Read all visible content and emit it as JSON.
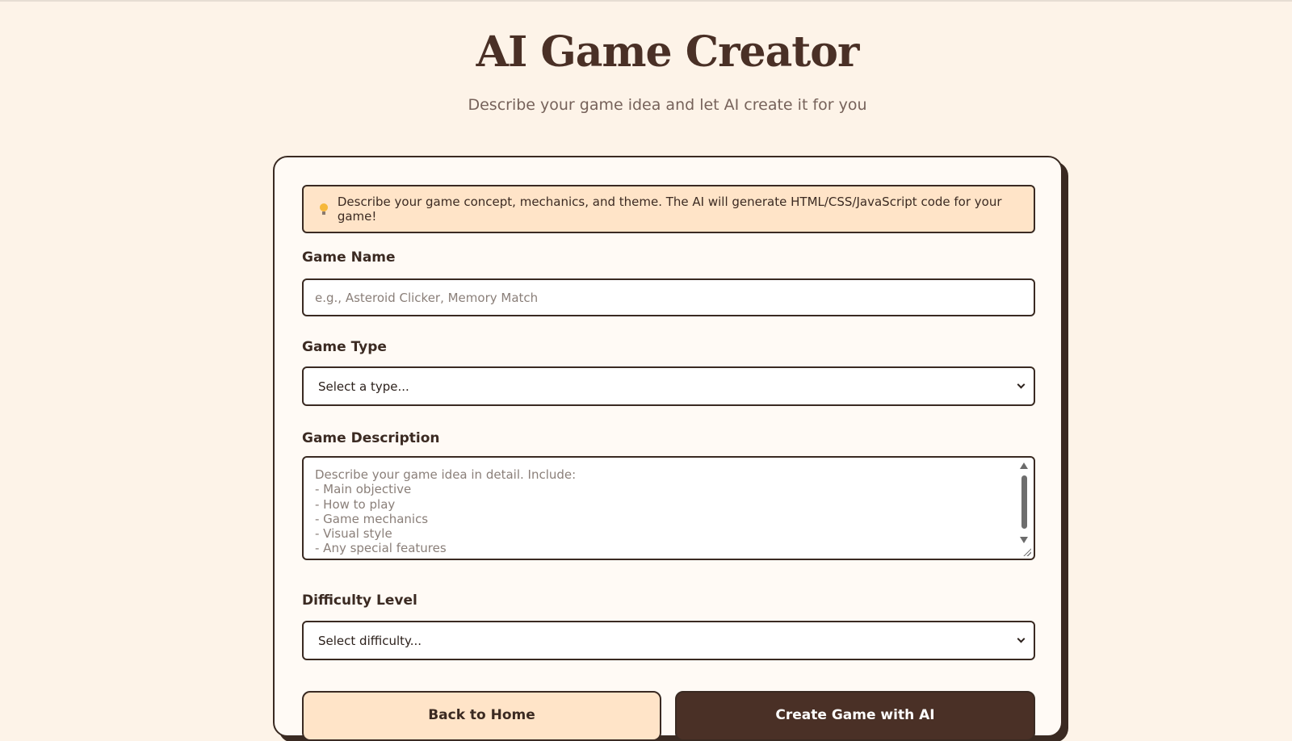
{
  "header": {
    "title": "AI Game Creator",
    "subtitle": "Describe your game idea and let AI create it for you"
  },
  "info": {
    "icon": "lightbulb-icon",
    "text": "Describe your game concept, mechanics, and theme. The AI will generate HTML/CSS/JavaScript code for your game!"
  },
  "form": {
    "game_name": {
      "label": "Game Name",
      "placeholder": "e.g., Asteroid Clicker, Memory Match",
      "value": ""
    },
    "game_type": {
      "label": "Game Type",
      "selected": "Select a type..."
    },
    "game_description": {
      "label": "Game Description",
      "placeholder_lines": [
        "Describe your game idea in detail. Include:",
        "- Main objective",
        "- How to play",
        "- Game mechanics",
        "- Visual style",
        "- Any special features"
      ]
    },
    "difficulty": {
      "label": "Difficulty Level",
      "selected": "Select difficulty..."
    }
  },
  "actions": {
    "back_label": "Back to Home",
    "create_label": "Create Game with AI"
  },
  "colors": {
    "background": "#fdf3e8",
    "accent_dark": "#4a3026",
    "info_background": "#ffe4c8"
  }
}
